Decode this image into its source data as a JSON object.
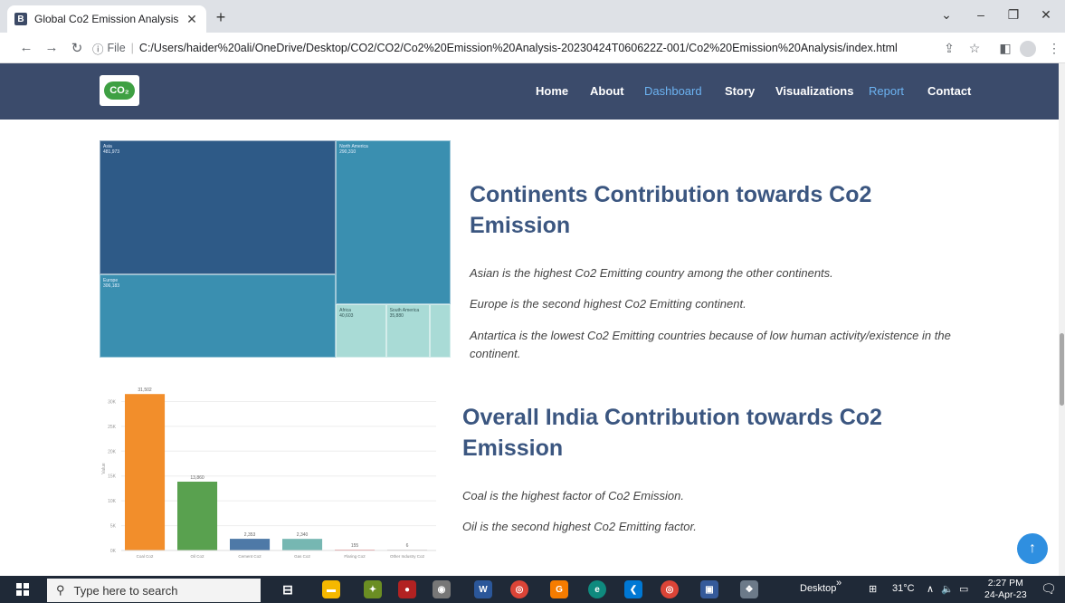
{
  "browser": {
    "tab_title": "Global Co2 Emission Analysis",
    "favicon_letter": "B",
    "url_prefix": "File",
    "url": "C:/Users/haider%20ali/OneDrive/Desktop/CO2/CO2/Co2%20Emission%20Analysis-20230424T060622Z-001/Co2%20Emission%20Analysis/index.html"
  },
  "site": {
    "logo_text": "CO₂",
    "nav": [
      {
        "label": "Home",
        "active": false
      },
      {
        "label": "About",
        "active": false
      },
      {
        "label": "Dashboard",
        "active": true
      },
      {
        "label": "Story",
        "active": false
      },
      {
        "label": "Visualizations",
        "active": false
      },
      {
        "label": "Report",
        "active": true
      },
      {
        "label": "Contact",
        "active": false
      }
    ]
  },
  "section1": {
    "heading": "Continents Contribution towards Co2 Emission",
    "paragraphs": [
      "Asian is the highest Co2 Emitting country among the other continents.",
      "Europe is the second highest Co2 Emitting continent.",
      "Antartica is the lowest Co2 Emitting countries because of low human activity/existence in the continent."
    ]
  },
  "section2": {
    "heading": "Overall India Contribution towards Co2 Emission",
    "paragraphs": [
      "Coal is the highest factor of Co2 Emission.",
      "Oil is the second highest Co2 Emitting factor."
    ]
  },
  "chart_data": [
    {
      "type": "treemap",
      "items": [
        {
          "label": "Asia",
          "value": 481973,
          "value_label": "481,973",
          "color": "#2e5a87"
        },
        {
          "label": "North America",
          "value": 290310,
          "value_label": "290,310",
          "color": "#3a8fb0"
        },
        {
          "label": "Europe",
          "value": 306183,
          "value_label": "306,183",
          "color": "#3a8fb0"
        },
        {
          "label": "Africa",
          "value": 40603,
          "value_label": "40,603",
          "color": "#a9dbd6"
        },
        {
          "label": "South America",
          "value": 35880,
          "value_label": "35,880",
          "color": "#a9dbd6"
        },
        {
          "label": "",
          "value": 8000,
          "value_label": "",
          "color": "#a9dbd6"
        }
      ]
    },
    {
      "type": "bar",
      "categories": [
        "Coal Co2",
        "Oil Co2",
        "Cement Co2",
        "Gas Co2",
        "Flaring Co2",
        "Other Industry Co2"
      ],
      "values": [
        31502,
        13860,
        2353,
        2340,
        155,
        6
      ],
      "value_labels": [
        "31,502",
        "13,860",
        "2,353",
        "2,340",
        "155",
        "6"
      ],
      "colors": [
        "#f28e2b",
        "#59a14f",
        "#4e79a7",
        "#76b7b2",
        "#e15759",
        "#bab0ac"
      ],
      "ylabel": "Value",
      "ylim": [
        0,
        33000
      ],
      "yticks": [
        0,
        5000,
        10000,
        15000,
        20000,
        25000,
        30000
      ],
      "ytick_labels": [
        "0K",
        "5K",
        "10K",
        "15K",
        "20K",
        "25K",
        "30K"
      ],
      "grid": true
    }
  ],
  "taskbar": {
    "search_placeholder": "Type here to search",
    "desktop_label": "Desktop",
    "weather": "31°C",
    "time": "2:27 PM",
    "date": "24-Apr-23"
  }
}
